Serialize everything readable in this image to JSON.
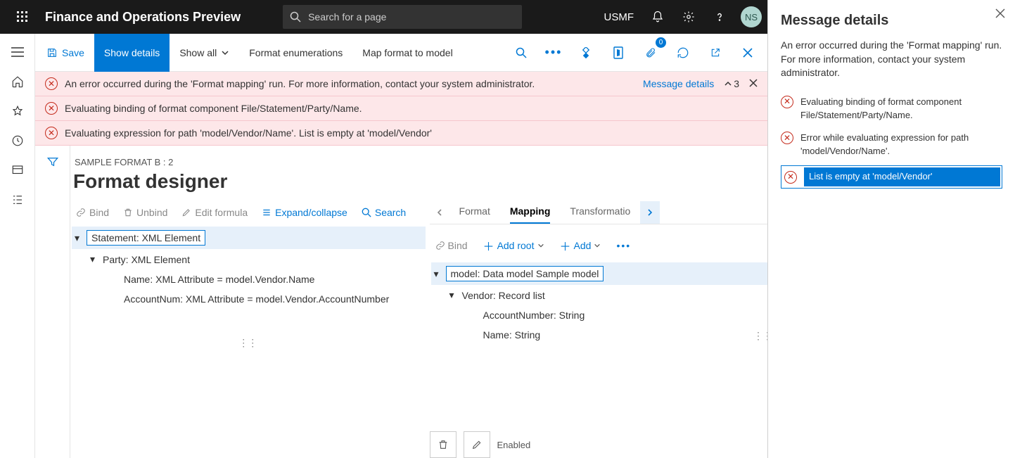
{
  "topbar": {
    "brand": "Finance and Operations Preview",
    "search_placeholder": "Search for a page",
    "entity": "USMF",
    "avatar_initials": "NS"
  },
  "actionbar": {
    "save": "Save",
    "show_details": "Show details",
    "show_all": "Show all",
    "format_enum": "Format enumerations",
    "map_format": "Map format to model",
    "attach_count": "0"
  },
  "banners": {
    "b1": "An error occurred during the 'Format mapping' run. For more information, contact your system administrator.",
    "b2": "Evaluating binding of format component File/Statement/Party/Name.",
    "b3": "Evaluating expression for path 'model/Vendor/Name'.   List is empty at 'model/Vendor'",
    "message_details": "Message details",
    "count": "3"
  },
  "designer": {
    "breadcrumb": "SAMPLE FORMAT B : 2",
    "title": "Format designer",
    "left_toolbar": {
      "bind": "Bind",
      "unbind": "Unbind",
      "edit_formula": "Edit formula",
      "expand": "Expand/collapse",
      "search": "Search"
    },
    "left_tree": {
      "n1": "Statement: XML Element",
      "n2": "Party: XML Element",
      "n3": "Name: XML Attribute = model.Vendor.Name",
      "n4": "AccountNum: XML Attribute = model.Vendor.AccountNumber"
    },
    "tabs": {
      "format": "Format",
      "mapping": "Mapping",
      "transformations": "Transformatio"
    },
    "right_toolbar": {
      "bind": "Bind",
      "add_root": "Add root",
      "add": "Add"
    },
    "right_tree": {
      "n1": "model: Data model Sample model",
      "n2": "Vendor: Record list",
      "n3": "AccountNumber: String",
      "n4": "Name: String"
    },
    "prop_label": "Enabled"
  },
  "sidepanel": {
    "title": "Message details",
    "intro": "An error occurred during the 'Format mapping' run. For more information, contact your system administrator.",
    "i1": "Evaluating binding of format component File/Statement/Party/Name.",
    "i2": "Error while evaluating expression for path 'model/Vendor/Name'.",
    "i3": "List is empty at 'model/Vendor'"
  }
}
